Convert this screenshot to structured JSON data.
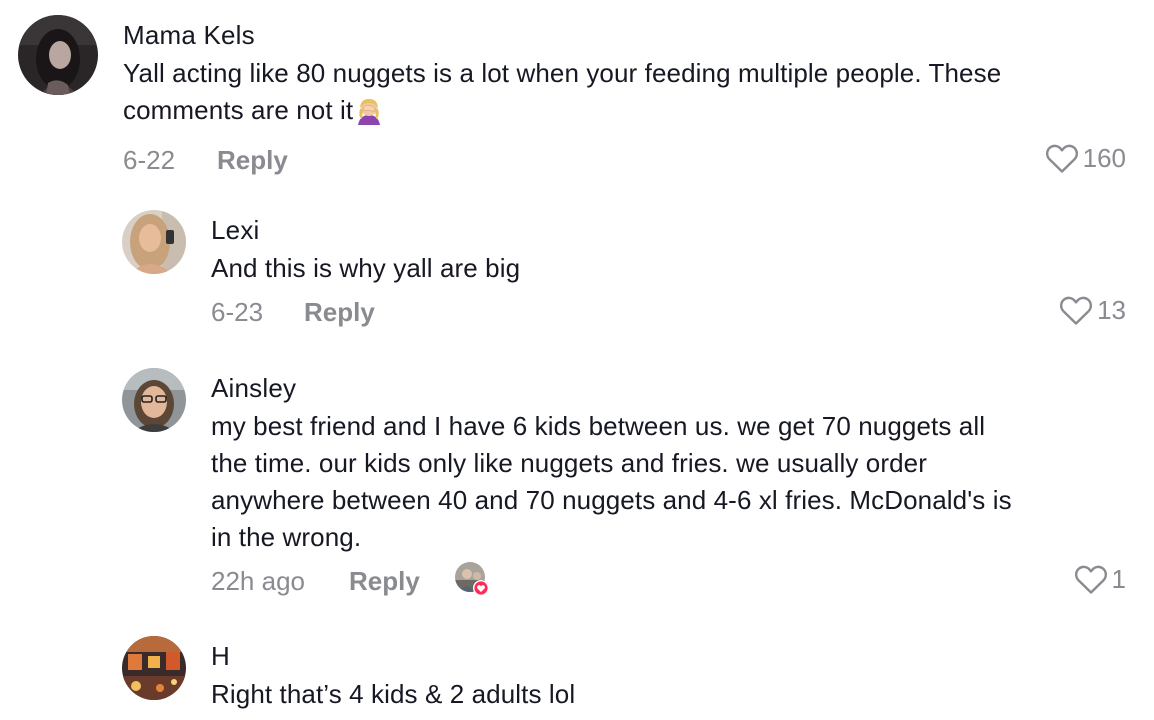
{
  "comments": [
    {
      "username": "Mama Kels",
      "text": "Yall acting like 80 nuggets is a lot when your feeding multiple people. These comments are not it",
      "emoji": "woman-facepalming-emoji",
      "date": "6-22",
      "reply_label": "Reply",
      "likes": "160"
    },
    {
      "username": "Lexi",
      "text": "And this is why yall are big",
      "date": "6-23",
      "reply_label": "Reply",
      "likes": "13"
    },
    {
      "username": "Ainsley",
      "text_lines": [
        "my best friend and I have 6 kids between us. we get 70 nuggets all",
        "the time. our kids only like nuggets and fries. we usually order",
        "anywhere between 40 and 70 nuggets and 4-6 xl fries. McDonald's is",
        "in the wrong."
      ],
      "date": "22h ago",
      "reply_label": "Reply",
      "liked_by_creator": true,
      "likes": "1"
    },
    {
      "username": "H",
      "text": "Right that’s 4 kids & 2 adults lol"
    }
  ],
  "icons": {
    "like": "heart-outline-icon",
    "creator_like_badge": "red-heart-badge-icon"
  },
  "colors": {
    "text": "#161823",
    "secondary": "#8a8b91",
    "heart_badge": "#fe2c55"
  }
}
